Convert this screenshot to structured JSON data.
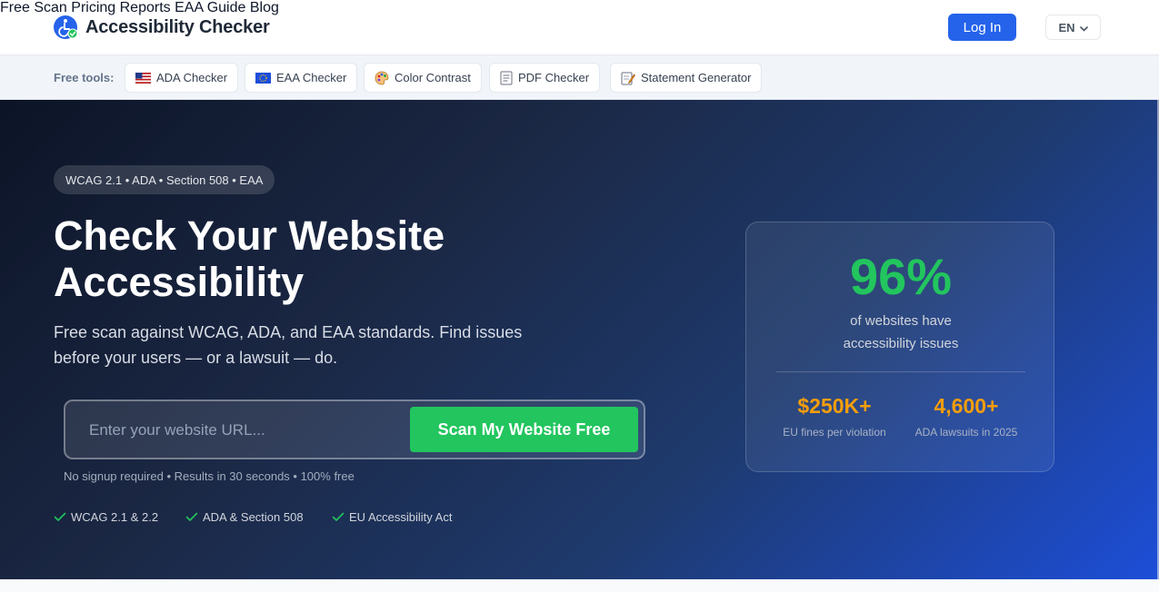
{
  "header": {
    "brand": "Accessibility Checker",
    "nav": [
      "Free Scan",
      "Pricing",
      "Reports",
      "EAA Guide",
      "Blog"
    ],
    "login_label": "Log In",
    "language": "EN"
  },
  "tools": {
    "label": "Free tools:",
    "items": [
      {
        "icon": "us-flag-icon",
        "label": "ADA Checker"
      },
      {
        "icon": "eu-flag-icon",
        "label": "EAA Checker"
      },
      {
        "icon": "palette-icon",
        "label": "Color Contrast"
      },
      {
        "icon": "document-icon",
        "label": "PDF Checker"
      },
      {
        "icon": "memo-icon",
        "label": "Statement Generator"
      }
    ]
  },
  "hero": {
    "standards_pill": "WCAG 2.1 • ADA • Section 508 • EAA",
    "title_line1": "Check Your Website",
    "title_line2": "Accessibility",
    "subtitle": "Free scan against WCAG, ADA, and EAA standards. Find issues before your users — or a lawsuit — do.",
    "search_placeholder": "Enter your website URL...",
    "search_value": "",
    "scan_button": "Scan My Website Free",
    "note": "No signup required • Results in 30 seconds • 100% free",
    "features": [
      "WCAG 2.1 & 2.2",
      "ADA & Section 508",
      "EU Accessibility Act"
    ]
  },
  "stats": {
    "headline_value": "96%",
    "headline_desc_line1": "of websites have",
    "headline_desc_line2": "accessibility issues",
    "items": [
      {
        "value": "$250K+",
        "label": "EU fines per violation"
      },
      {
        "value": "4,600+",
        "label": "ADA lawsuits in 2025"
      }
    ]
  },
  "colors": {
    "primary": "#2563eb",
    "success": "#22c55e",
    "warning": "#f59e0b",
    "hero_dark": "#0c1426"
  }
}
